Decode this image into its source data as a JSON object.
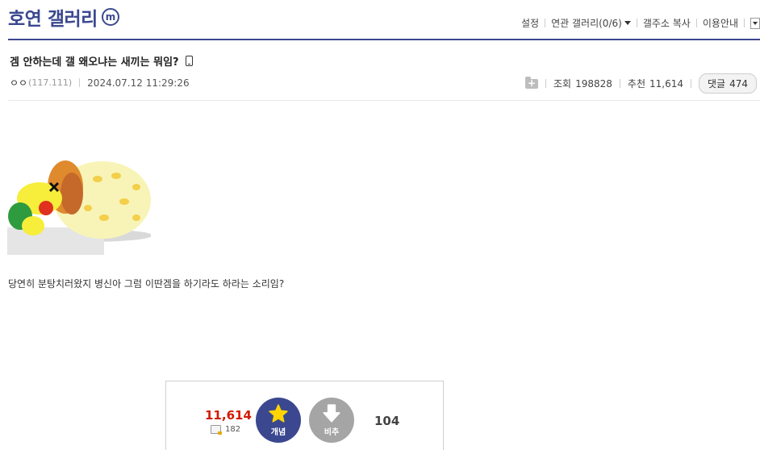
{
  "header": {
    "title": "호연 갤러리",
    "badge": "m",
    "menu": {
      "settings": "설정",
      "related": "연관 갤러리(0/6)",
      "copy_address": "갤주소 복사",
      "guide": "이용안내"
    }
  },
  "post": {
    "title": "겜 안하는데 갤 왜오냐는 새끼는 뭐임?",
    "writer": "ㅇㅇ",
    "ip": "(117.111)",
    "date": "2024.07.12 11:29:26",
    "views_label": "조회",
    "views": "198828",
    "recommend_label": "추천",
    "recommend": "11,614",
    "comments_label": "댓글",
    "comments": "474",
    "body_text": "당연히 분탕치러왔지 병신아 그럼 이딴겜을 하기라도 하라는 소리임?"
  },
  "recommend_box": {
    "up_count": "11,614",
    "fix_count": "182",
    "up_label": "개념",
    "down_label": "비추",
    "down_count": "104"
  },
  "colors": {
    "brand": "#3b4890",
    "up_count": "#d31900",
    "down_button": "#a5a5a5"
  }
}
